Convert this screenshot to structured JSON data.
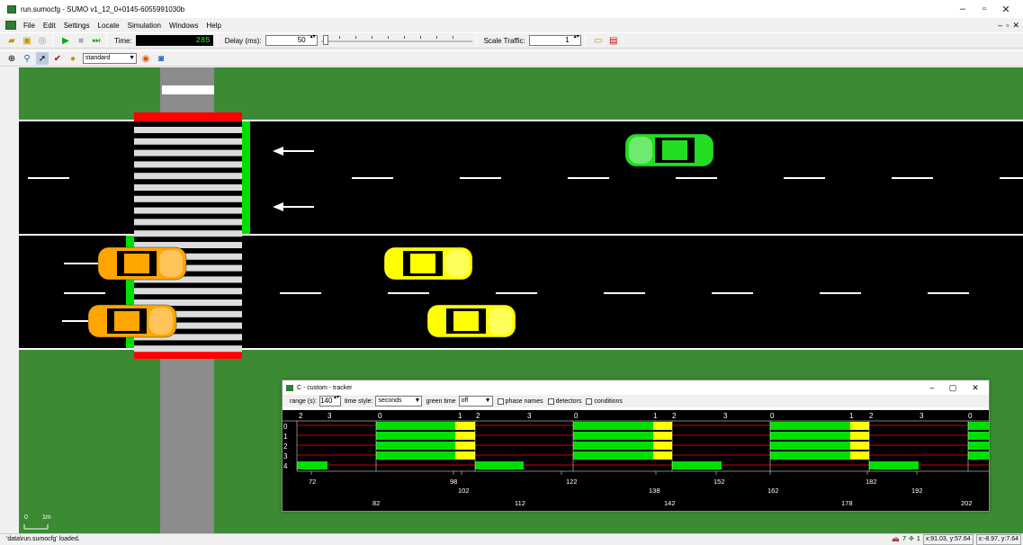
{
  "window": {
    "title": "run.sumocfg - SUMO v1_12_0+0145-6055991030b",
    "minimize": "–",
    "restore": "▫",
    "close": "✕"
  },
  "menu": [
    "File",
    "Edit",
    "Settings",
    "Locate",
    "Simulation",
    "Windows",
    "Help"
  ],
  "toolbar": {
    "time_label": "Time:",
    "time_value": "285",
    "delay_label": "Delay (ms):",
    "delay_value": "50",
    "scale_label": "Scale Traffic:",
    "scale_value": "1"
  },
  "view_toolbar": {
    "scheme": "standard"
  },
  "scale_bar": {
    "start": "0",
    "end": "1m"
  },
  "status": {
    "message": "'data\\run.sumocfg' loaded.",
    "vehicles": "7",
    "persons": "1",
    "coords1": "x:91.03, y:57.64",
    "coords2": "x:-8.97, y:7.64"
  },
  "tracker": {
    "title": "C - custom - tracker",
    "range_label": "range (s):",
    "range_value": "140",
    "time_style_label": "time style:",
    "time_style_value": "seconds",
    "green_time_label": "green time",
    "green_time_value": "off",
    "phase_names": "phase names",
    "detectors": "detectors",
    "conditions": "conditions",
    "row_labels": [
      "0",
      "1",
      "2",
      "3",
      "4"
    ],
    "phase_indices": [
      "2",
      "3",
      "0",
      "1",
      "2",
      "3",
      "0",
      "1",
      "2",
      "3",
      "0",
      "1",
      "2",
      "3",
      "0"
    ],
    "axis_top": [
      "72",
      "98",
      "102",
      "122",
      "138",
      "152",
      "162",
      "182",
      "192"
    ],
    "axis_bottom": [
      "82",
      "112",
      "142",
      "178",
      "202"
    ]
  },
  "colors": {
    "grass": "#3c8a34",
    "road": "#000000",
    "crossing_red": "#ff0000",
    "signal_green": "#00e000",
    "signal_yellow": "#ffff00",
    "car_yellow": "#ffff00",
    "car_orange": "#ffa500",
    "car_green": "#22dd22"
  }
}
